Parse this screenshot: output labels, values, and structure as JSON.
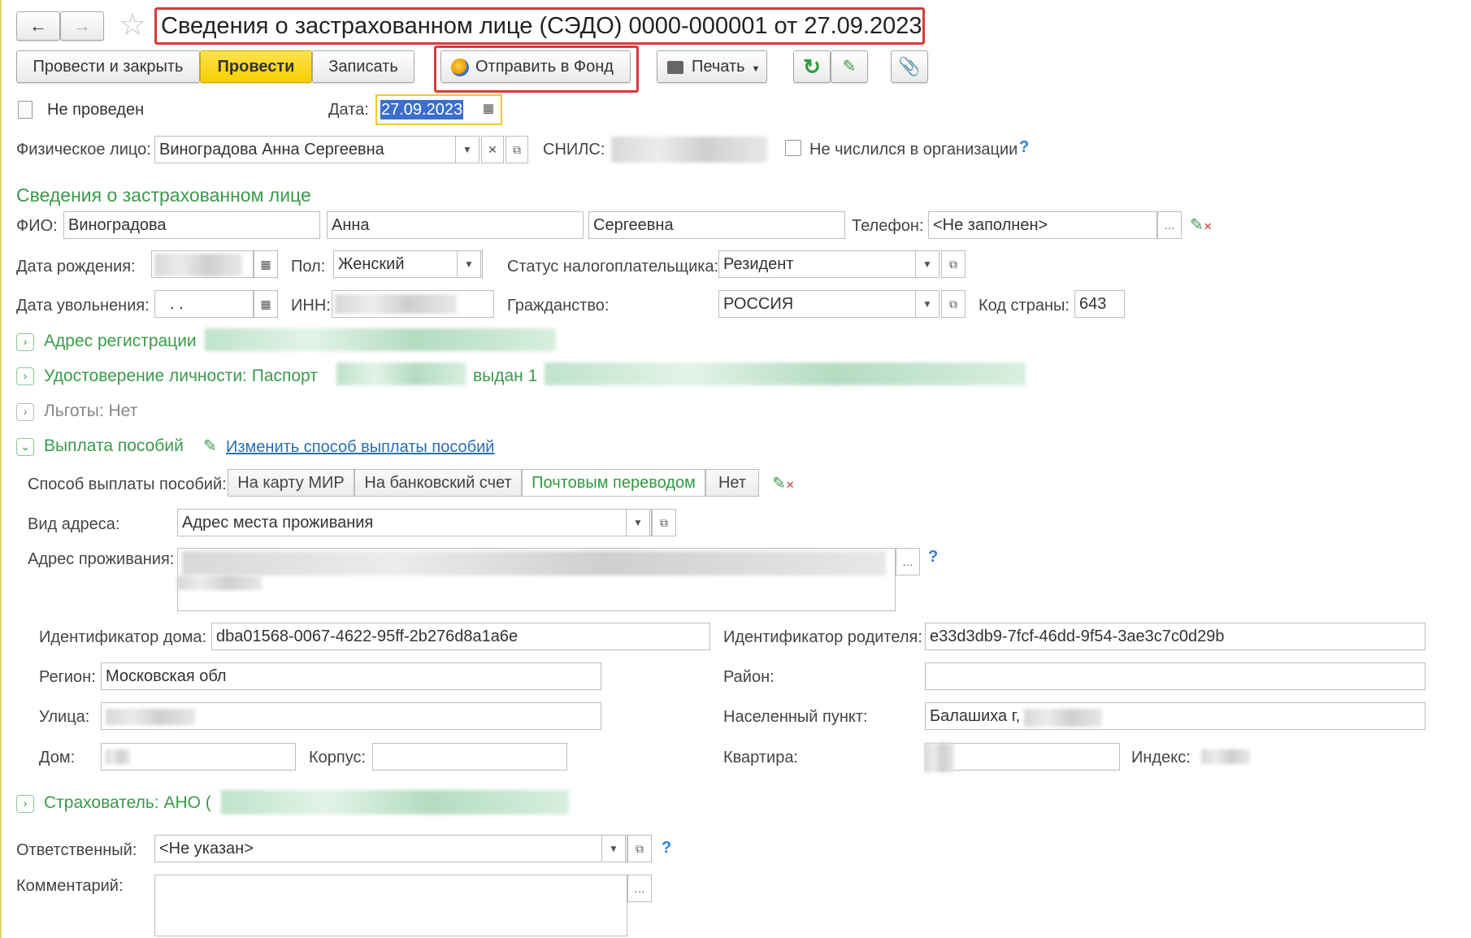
{
  "title": "Сведения о застрахованном лице (СЭДО) 0000-000001 от 27.09.2023",
  "toolbar": {
    "post_close": "Провести и закрыть",
    "post": "Провести",
    "save": "Записать",
    "send": "Отправить в Фонд",
    "print": "Печать"
  },
  "status": "Не проведен",
  "date_label": "Дата:",
  "date": "27.09.2023",
  "person_label": "Физическое лицо:",
  "person": "Виноградова Анна Сергеевна",
  "snils_label": "СНИЛС:",
  "not_listed": "Не числился в организации",
  "section_insured": "Сведения о застрахованном лице",
  "fio_label": "ФИО:",
  "last_name": "Виноградова",
  "first_name": "Анна",
  "middle_name": "Сергеевна",
  "phone_label": "Телефон:",
  "phone": "<Не заполнен>",
  "birth_label": "Дата рождения:",
  "gender_label": "Пол:",
  "gender": "Женский",
  "tax_status_label": "Статус налогоплательщика:",
  "tax_status": "Резидент",
  "dismiss_label": "Дата увольнения:",
  "dismiss_value": " .  .",
  "inn_label": "ИНН:",
  "citizenship_label": "Гражданство:",
  "citizenship": "РОССИЯ",
  "country_code_label": "Код страны:",
  "country_code": "643",
  "reg_address": "Адрес регистрации",
  "id_doc": "Удостоверение личности: Паспорт",
  "id_issued": "выдан 1",
  "benefits_privileges": "Льготы: Нет",
  "payment_section": "Выплата пособий",
  "change_payment": "Изменить способ выплаты пособий",
  "payment_method_label": "Способ выплаты пособий:",
  "payment_methods": [
    "На карту МИР",
    "На банковский счет",
    "Почтовым переводом",
    "Нет"
  ],
  "address_type_label": "Вид адреса:",
  "address_type": "Адрес места проживания",
  "address_label": "Адрес проживания:",
  "house_id_label": "Идентификатор дома:",
  "house_id": "dba01568-0067-4622-95ff-2b276d8a1a6e",
  "parent_id_label": "Идентификатор родителя:",
  "parent_id": "e33d3db9-7fcf-46dd-9f54-3ae3c7c0d29b",
  "region_label": "Регион:",
  "region": "Московская обл",
  "district_label": "Район:",
  "street_label": "Улица:",
  "locality_label": "Населенный пункт:",
  "locality": "Балашиха г,",
  "house_label": "Дом:",
  "building_label": "Корпус:",
  "apartment_label": "Квартира:",
  "index_label": "Индекс:",
  "insurer": "Страхователь: АНО (",
  "responsible_label": "Ответственный:",
  "responsible": "<Не указан>",
  "comment_label": "Комментарий:",
  "accent": "#3a9a4b",
  "highlight": "#ffd500"
}
